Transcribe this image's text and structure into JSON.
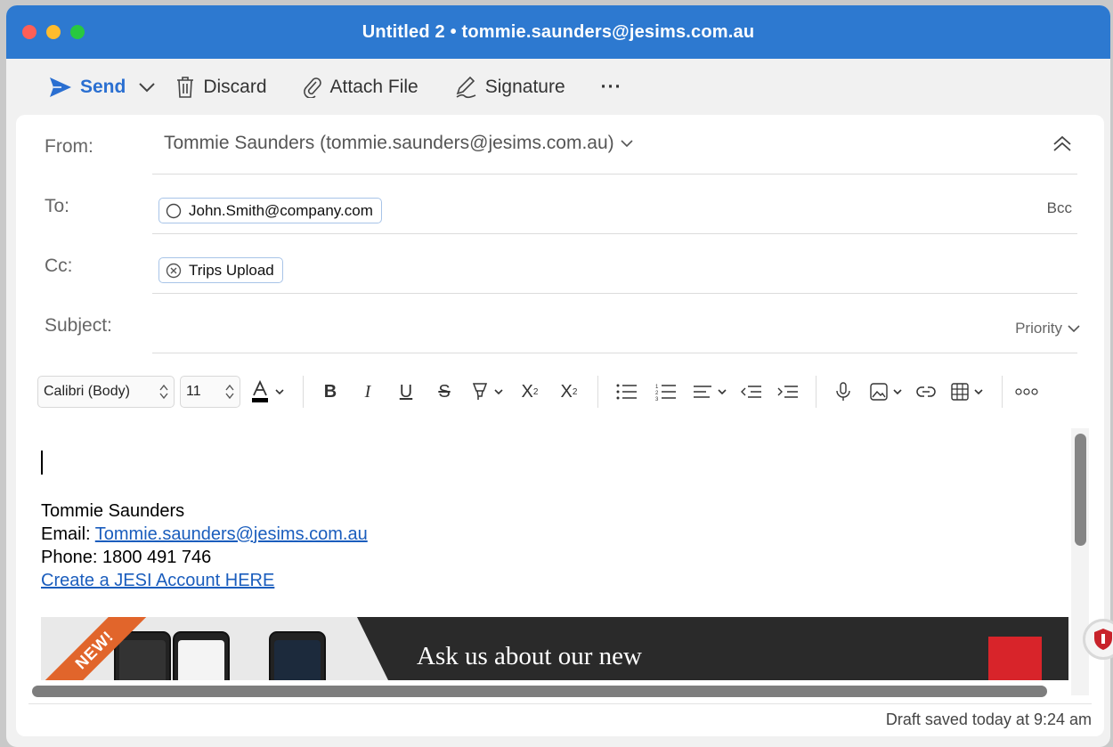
{
  "window": {
    "title": "Untitled 2 • tommie.saunders@jesims.com.au"
  },
  "toolbar": {
    "send_label": "Send",
    "discard_label": "Discard",
    "attach_label": "Attach File",
    "signature_label": "Signature",
    "more_label": "···"
  },
  "header": {
    "from_label": "From:",
    "from_value": "Tommie Saunders (tommie.saunders@jesims.com.au)",
    "to_label": "To:",
    "to_recipient": "John.Smith@company.com",
    "bcc_label": "Bcc",
    "cc_label": "Cc:",
    "cc_recipient": "Trips Upload",
    "subject_label": "Subject:",
    "subject_value": "",
    "priority_label": "Priority"
  },
  "format": {
    "font_name": "Calibri (Body)",
    "font_size": "11"
  },
  "signature": {
    "name": "Tommie Saunders",
    "email_prefix": "Email: ",
    "email_link": "Tommie.saunders@jesims.com.au",
    "phone": "Phone: 1800 491 746",
    "account_link": "Create a JESI Account HERE"
  },
  "banner": {
    "ribbon": "NEW!",
    "headline": "Ask us about our new"
  },
  "status": {
    "draft_saved": "Draft saved today at 9:24 am"
  },
  "colors": {
    "titlebar": "#2d79d0",
    "accent": "#2a6fd1",
    "link": "#1a5dbd"
  }
}
